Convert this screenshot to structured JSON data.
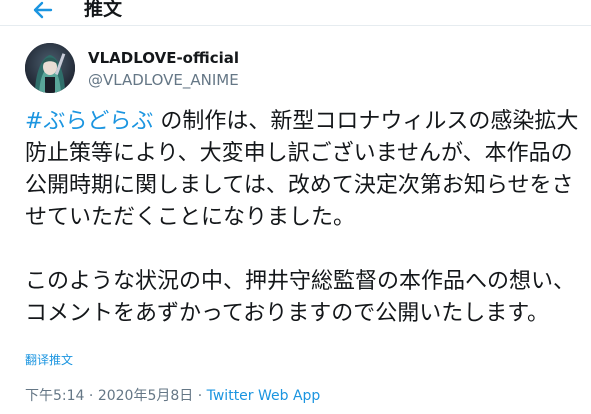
{
  "header": {
    "back_icon": "arrow-left-icon",
    "title": "推文"
  },
  "author": {
    "display_name": "VLADLOVE-official",
    "handle": "@VLADLOVE_ANIME",
    "avatar_icon": "avatar-image"
  },
  "tweet": {
    "hashtag": "#ぶらどらぶ",
    "text_after_hashtag": " の制作は、新型コロナウィルスの感染拡大防止策等により、大変申し訳ございませんが、本作品の公開時期に関しましては、改めて決定次第お知らせをさせていただくことになりました。\n\nこのような状況の中、押井守総監督の本作品への想い、コメントをあずかっておりますので公開いたします。",
    "translate_label": "翻译推文"
  },
  "meta": {
    "time": "下午5:14",
    "separator": " · ",
    "date": "2020年5月8日",
    "separator2": " · ",
    "source": "Twitter Web App"
  },
  "colors": {
    "accent": "#1b95e0",
    "text": "#14171a",
    "muted": "#657786"
  }
}
